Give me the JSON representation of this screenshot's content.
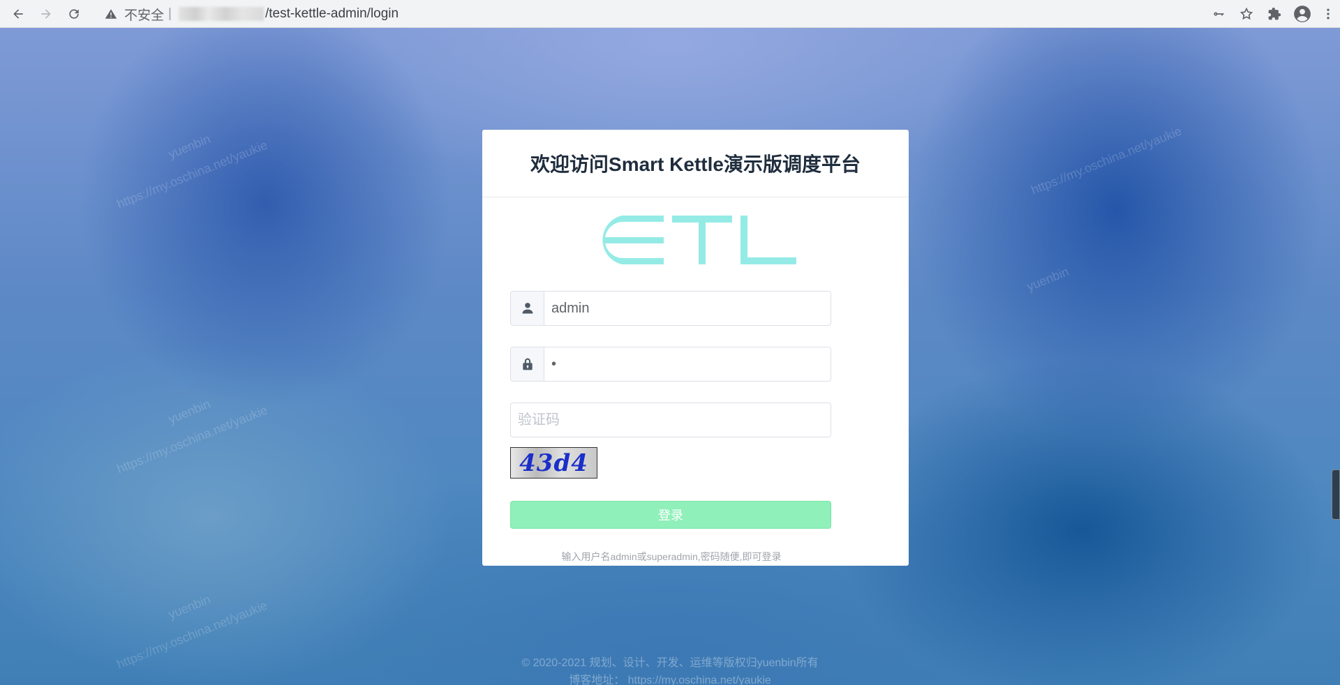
{
  "browser": {
    "security_label": "不安全",
    "separator": "|",
    "url_path": "/test-kettle-admin/login"
  },
  "icons": {
    "back": "back-arrow-icon",
    "forward": "forward-arrow-icon",
    "reload": "reload-icon",
    "warning": "warning-icon",
    "key": "key-icon",
    "star": "star-icon",
    "extensions": "puzzle-icon",
    "profile": "profile-icon",
    "menu": "kebab-menu-icon",
    "user": "user-icon",
    "lock": "lock-icon"
  },
  "login": {
    "title": "欢迎访问Smart Kettle演示版调度平台",
    "logo_text": "ETL",
    "username_value": "admin",
    "password_value": "•",
    "captcha_placeholder": "验证码",
    "captcha_image_text": "43d4",
    "submit_label": "登录",
    "hint": "输入用户名admin或superadmin,密码随便,即可登录"
  },
  "watermark": {
    "name": "yuenbin",
    "url": "https://my.oschina.net/yaukie"
  },
  "footer": {
    "copyright": "© 2020-2021 规划、设计、开发、运维等版权归yuenbin所有",
    "blog": "博客地址： https://my.oschina.net/yaukie"
  },
  "colors": {
    "logo": "#94ebe6",
    "button": "#8ff0b9",
    "title": "#1f2d3d"
  }
}
